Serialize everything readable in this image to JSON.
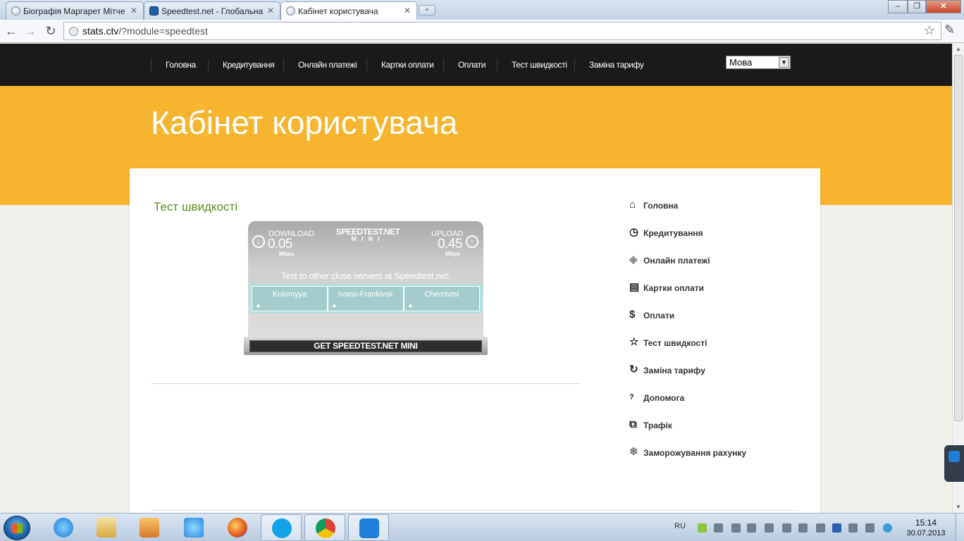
{
  "browser": {
    "tabs": [
      {
        "title": "Біографія Маргарет Мітче",
        "active": false
      },
      {
        "title": "Speedtest.net - Глобальна",
        "active": false
      },
      {
        "title": "Кабінет користувача",
        "active": true
      }
    ],
    "url_host": "stats.ctv",
    "url_path": "/?module=speedtest"
  },
  "nav": {
    "items": [
      "Головна",
      "Кредитування",
      "Онлайн платежі",
      "Картки оплати",
      "Оплати",
      "Тест швидкості",
      "Заміна тарифу"
    ],
    "language_select": "Мова"
  },
  "hero": {
    "title": "Кабінет користувача"
  },
  "main": {
    "section_title": "Тест швидкості",
    "speedtest": {
      "logo": "SPEEDTEST.NET",
      "logo_sub": "MINI",
      "download_label": "DOWNLOAD",
      "download_value": "0.05",
      "download_unit": "Mbps",
      "upload_label": "UPLOAD",
      "upload_value": "0.45",
      "upload_unit": "Mbps",
      "servers_title": "Test to other close servers at Speedtest.net:",
      "servers": [
        "Kolomyya",
        "Ivano-Frankivsk",
        "Chernivtsi"
      ],
      "get_button": "GET SPEEDTEST.NET MINI"
    }
  },
  "sidebar": {
    "items": [
      {
        "label": "Головна",
        "icon": "home-icon"
      },
      {
        "label": "Кредитування",
        "icon": "clock-icon"
      },
      {
        "label": "Онлайн платежі",
        "icon": "card-icon"
      },
      {
        "label": "Картки оплати",
        "icon": "document-icon"
      },
      {
        "label": "Оплати",
        "icon": "dollar-icon"
      },
      {
        "label": "Тест швидкості",
        "icon": "star-icon"
      },
      {
        "label": "Заміна тарифу",
        "icon": "refresh-icon"
      },
      {
        "label": "Допомога",
        "icon": "question-icon"
      },
      {
        "label": "Трафік",
        "icon": "chart-icon"
      },
      {
        "label": "Заморожування рахунку",
        "icon": "snowflake-icon"
      }
    ]
  },
  "taskbar": {
    "language": "RU",
    "time": "15:14",
    "date": "30.07.2013",
    "apps": [
      "internet-explorer",
      "file-explorer",
      "media-player",
      "internet-explorer-pinned",
      "firefox",
      "skype",
      "chrome",
      "teamviewer"
    ]
  },
  "colors": {
    "hero_bg": "#f7b52f",
    "nav_bg": "#1a1a1a",
    "section_title": "#5a8f1f"
  }
}
